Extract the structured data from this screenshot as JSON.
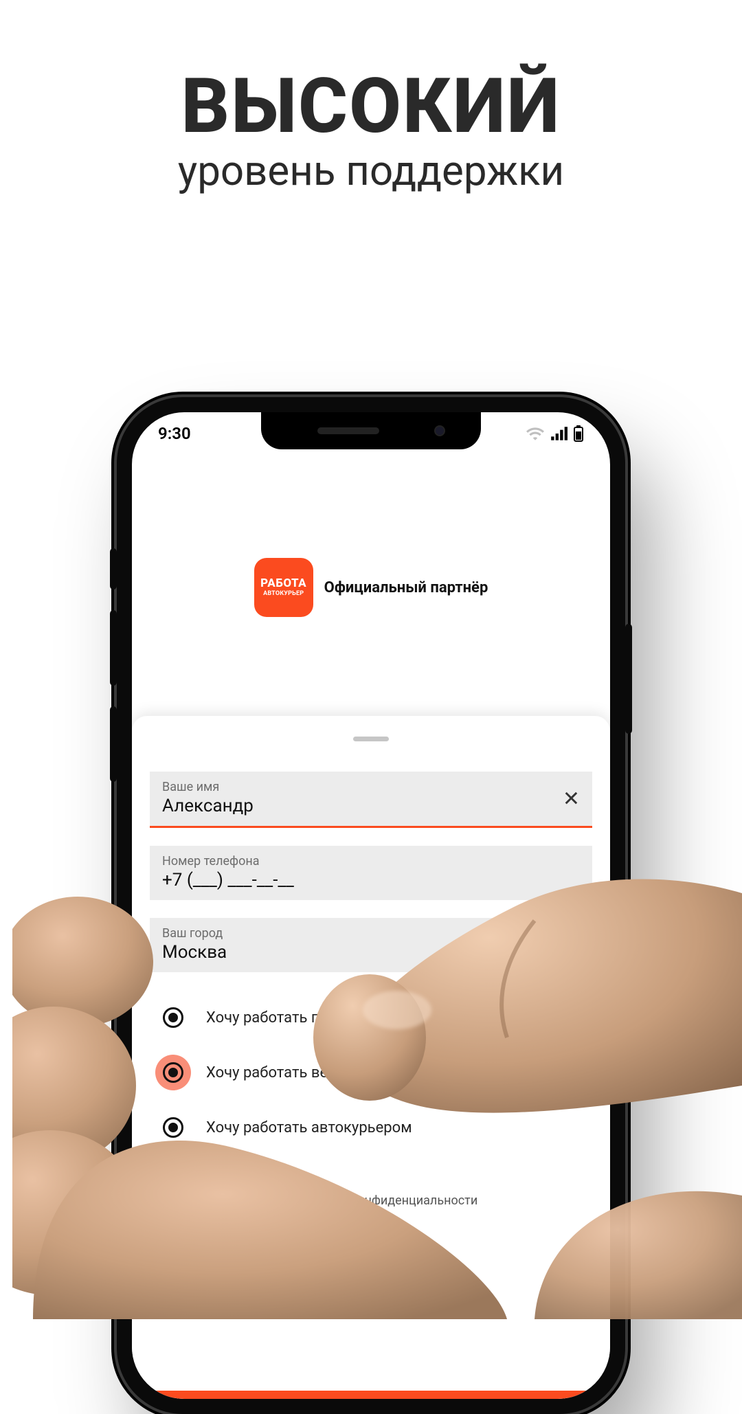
{
  "headline": {
    "big": "ВЫСОКИЙ",
    "sub": "уровень поддержки"
  },
  "status": {
    "time": "9:30"
  },
  "brand": {
    "logo_line1": "РАБОТА",
    "logo_line2": "АВТОКУРЬЕР",
    "partner": "Официальный партнёр"
  },
  "form": {
    "name": {
      "label": "Ваше имя",
      "value": "Александр"
    },
    "phone": {
      "label": "Номер телефона",
      "value": "+7 (___) ___-__-__"
    },
    "city": {
      "label": "Ваш город",
      "value": "Москва"
    },
    "options": [
      {
        "label": "Хочу работать пешим курьерм",
        "selected": false
      },
      {
        "label": "Хочу работать вело/мото курьером",
        "selected": true
      },
      {
        "label": "Хочу работать автокурьером",
        "selected": false
      }
    ],
    "consent": {
      "label": "Я соглашаюсь с политикой конфиденциальности",
      "checked": true
    }
  },
  "colors": {
    "accent": "#fb4b1f"
  }
}
